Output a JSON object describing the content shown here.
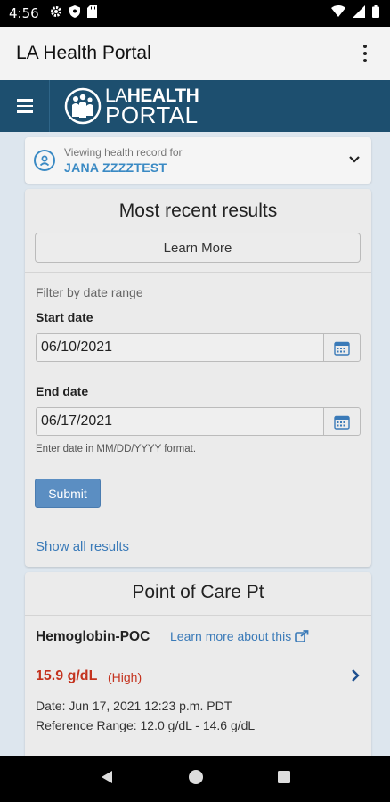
{
  "status_bar": {
    "time": "4:56"
  },
  "app_bar": {
    "title": "LA Health Portal"
  },
  "site_header": {
    "logo_line1_a": "LA",
    "logo_line1_b": "HEALTH",
    "logo_line2": "PORTAL"
  },
  "record": {
    "label": "Viewing health record for",
    "name": "JANA ZZZZTEST"
  },
  "results": {
    "title": "Most recent results",
    "learn_more": "Learn More",
    "filter_label": "Filter by date range",
    "start_label": "Start date",
    "start_value": "06/10/2021",
    "end_label": "End date",
    "end_value": "06/17/2021",
    "hint": "Enter date in MM/DD/YYYY format.",
    "submit": "Submit",
    "show_all": "Show all results"
  },
  "poc": {
    "title": "Point of Care Pt",
    "test_name": "Hemoglobin-POC",
    "learn_link": "Learn more about this",
    "value": "15.9 g/dL",
    "flag": "(High)",
    "date_line": "Date:  Jun 17, 2021 12:23 p.m. PDT",
    "range_line": "Reference Range:  12.0 g/dL - 14.6 g/dL"
  },
  "colors": {
    "header_bg": "#1d4f6f",
    "link": "#3a7ab8",
    "high": "#c4331f",
    "submit_bg": "#5b8ec2"
  }
}
